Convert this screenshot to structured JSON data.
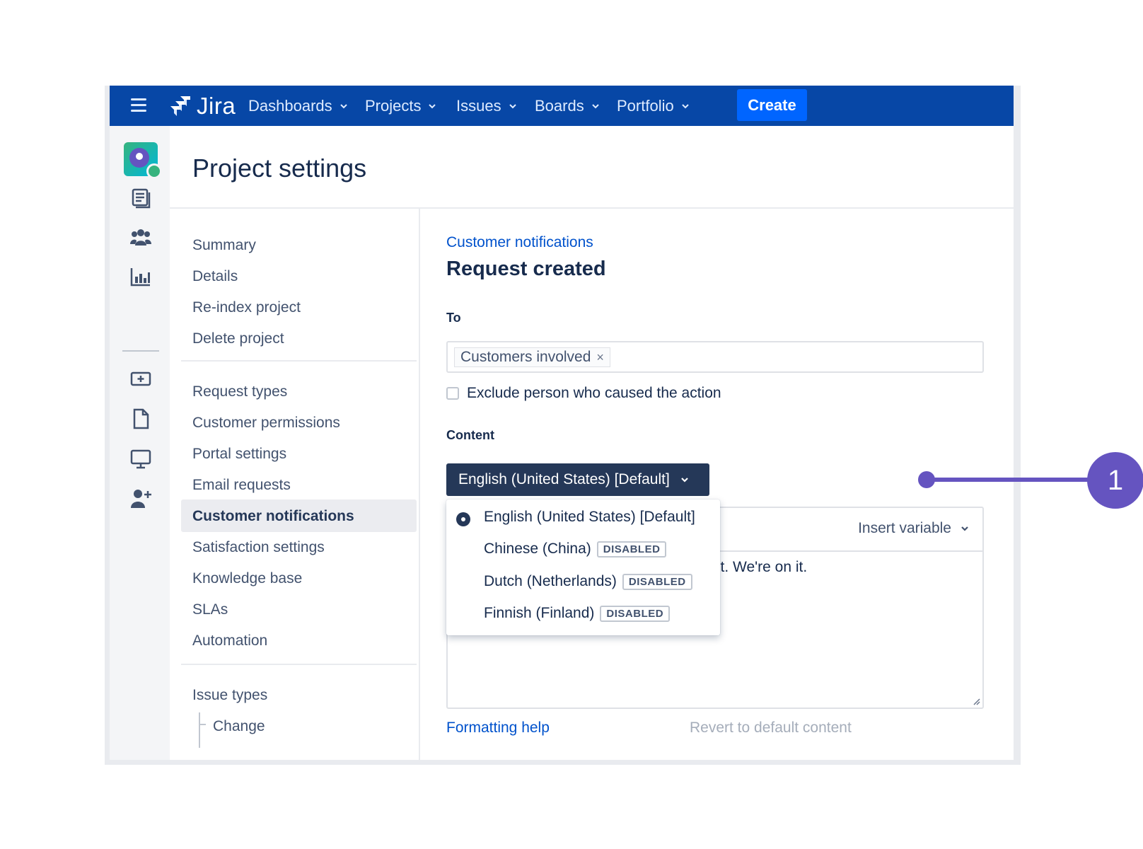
{
  "topnav": {
    "logo_text": "Jira",
    "items": [
      "Dashboards",
      "Projects",
      "Issues",
      "Boards",
      "Portfolio"
    ],
    "create_label": "Create",
    "color": "#0747a6"
  },
  "header": {
    "title": "Project settings"
  },
  "settings_nav": {
    "group1": [
      "Summary",
      "Details",
      "Re-index project",
      "Delete project"
    ],
    "group2": [
      "Request types",
      "Customer permissions",
      "Portal settings",
      "Email requests",
      "Customer notifications",
      "Satisfaction settings",
      "Knowledge base",
      "SLAs",
      "Automation"
    ],
    "group3": [
      "Issue types"
    ],
    "sub_item": "Change",
    "active": "Customer notifications"
  },
  "main": {
    "breadcrumb": "Customer notifications",
    "title": "Request created",
    "to_label": "To",
    "to_chip": "Customers involved",
    "chip_remove": "×",
    "exclude_label": "Exclude person who caused the action",
    "content_label": "Content",
    "language_selected": "English (United States) [Default]",
    "insert_variable": "Insert variable",
    "editor_text": "st. We're on it.",
    "formatting_help": "Formatting help",
    "revert": "Revert to default content"
  },
  "dropdown": {
    "options": [
      {
        "label": "English (United States) [Default]",
        "selected": true,
        "badge": ""
      },
      {
        "label": "Chinese (China)",
        "selected": false,
        "badge": "DISABLED"
      },
      {
        "label": "Dutch (Netherlands)",
        "selected": false,
        "badge": "DISABLED"
      },
      {
        "label": "Finnish (Finland)",
        "selected": false,
        "badge": "DISABLED"
      }
    ]
  },
  "callout": {
    "number": "1",
    "color": "#6554c0"
  }
}
